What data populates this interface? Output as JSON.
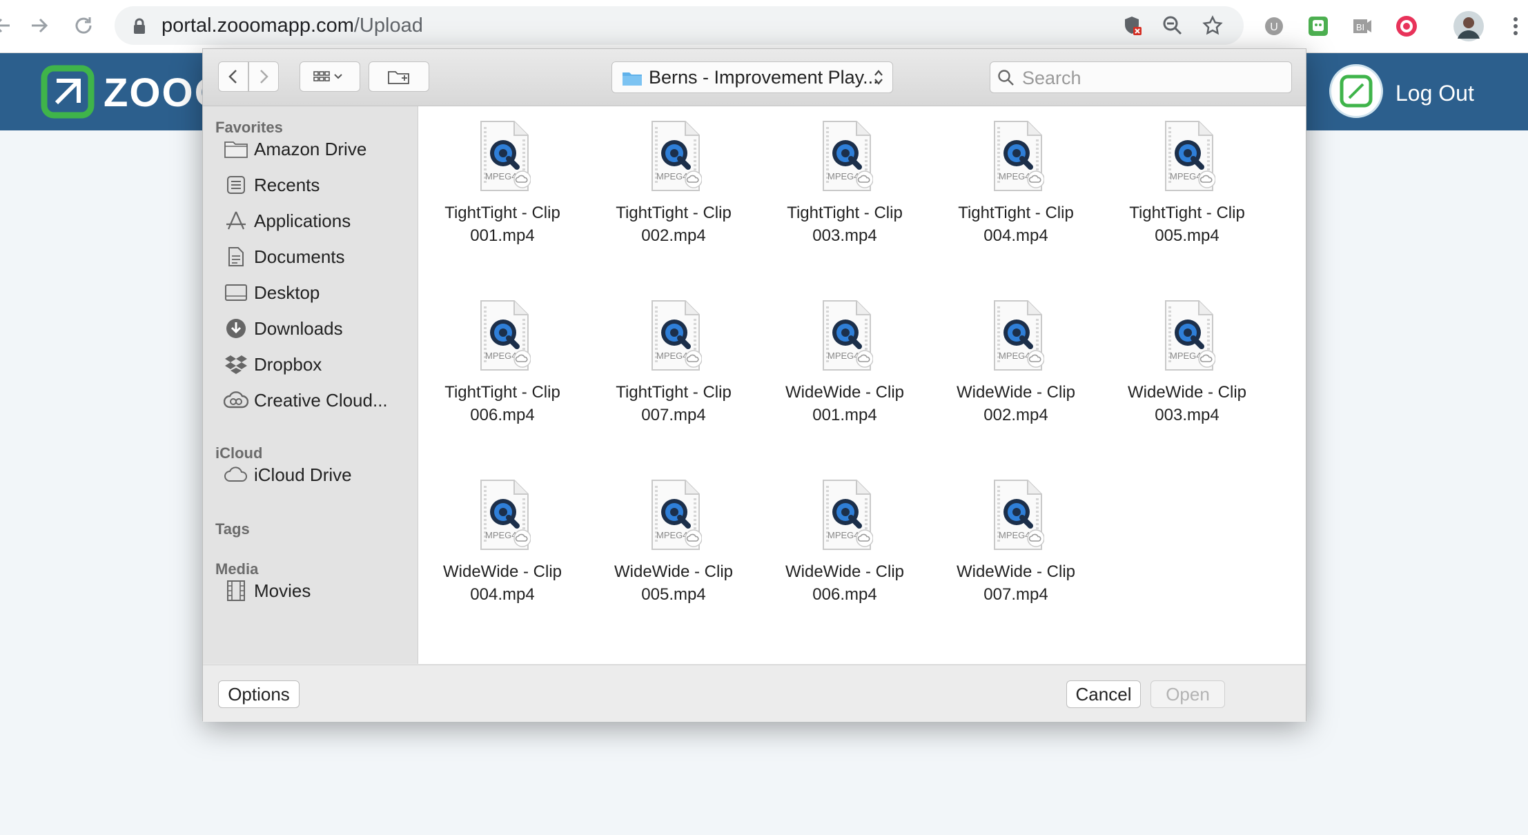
{
  "browser": {
    "url_host": "portal.zooomapp.com",
    "url_path": "/Upload"
  },
  "site": {
    "logo_text": "ZOOO",
    "logout_label": "Log Out",
    "brand_color": "#2c5f8d",
    "logo_green": "#3fb44a"
  },
  "dialog": {
    "path_label": "Berns - Improvement Play...",
    "search_placeholder": "Search",
    "sidebar": {
      "favorites_title": "Favorites",
      "favorites": [
        {
          "label": "Amazon Drive",
          "icon": "folder-icon"
        },
        {
          "label": "Recents",
          "icon": "recents-icon"
        },
        {
          "label": "Applications",
          "icon": "applications-icon"
        },
        {
          "label": "Documents",
          "icon": "documents-icon"
        },
        {
          "label": "Desktop",
          "icon": "desktop-icon"
        },
        {
          "label": "Downloads",
          "icon": "downloads-icon"
        },
        {
          "label": "Dropbox",
          "icon": "dropbox-icon"
        },
        {
          "label": "Creative Cloud...",
          "icon": "creative-cloud-icon"
        }
      ],
      "icloud_title": "iCloud",
      "icloud": [
        {
          "label": "iCloud Drive",
          "icon": "icloud-icon"
        }
      ],
      "tags_title": "Tags",
      "media_title": "Media",
      "media": [
        {
          "label": "Movies",
          "icon": "movies-icon"
        }
      ]
    },
    "file_type_badge": "MPEG4",
    "files": [
      {
        "line1": "TightTight - Clip",
        "line2": "001.mp4"
      },
      {
        "line1": "TightTight - Clip",
        "line2": "002.mp4"
      },
      {
        "line1": "TightTight - Clip",
        "line2": "003.mp4"
      },
      {
        "line1": "TightTight - Clip",
        "line2": "004.mp4"
      },
      {
        "line1": "TightTight - Clip",
        "line2": "005.mp4"
      },
      {
        "line1": "TightTight - Clip",
        "line2": "006.mp4"
      },
      {
        "line1": "TightTight - Clip",
        "line2": "007.mp4"
      },
      {
        "line1": "WideWide - Clip",
        "line2": "001.mp4"
      },
      {
        "line1": "WideWide - Clip",
        "line2": "002.mp4"
      },
      {
        "line1": "WideWide - Clip",
        "line2": "003.mp4"
      },
      {
        "line1": "WideWide - Clip",
        "line2": "004.mp4"
      },
      {
        "line1": "WideWide - Clip",
        "line2": "005.mp4"
      },
      {
        "line1": "WideWide - Clip",
        "line2": "006.mp4"
      },
      {
        "line1": "WideWide - Clip",
        "line2": "007.mp4"
      }
    ],
    "options_label": "Options",
    "cancel_label": "Cancel",
    "open_label": "Open"
  }
}
